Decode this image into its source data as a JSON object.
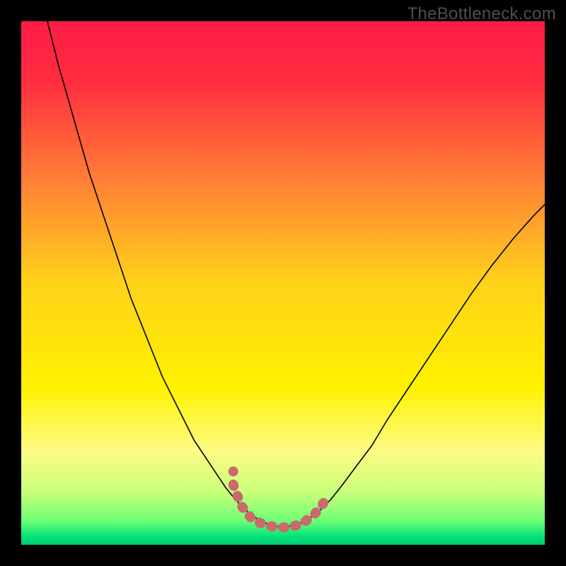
{
  "watermark": "TheBottleneck.com",
  "chart_data": {
    "type": "line",
    "title": "",
    "xlabel": "",
    "ylabel": "",
    "xlim": [
      0,
      100
    ],
    "ylim": [
      0,
      100
    ],
    "background_gradient": {
      "stops": [
        {
          "pos": 0.0,
          "color": "#ff1a47"
        },
        {
          "pos": 0.12,
          "color": "#ff2f3f"
        },
        {
          "pos": 0.3,
          "color": "#ff7e36"
        },
        {
          "pos": 0.5,
          "color": "#ffd21a"
        },
        {
          "pos": 0.7,
          "color": "#fff200"
        },
        {
          "pos": 0.82,
          "color": "#fffb85"
        },
        {
          "pos": 0.9,
          "color": "#c9ff7a"
        },
        {
          "pos": 0.955,
          "color": "#6bff74"
        },
        {
          "pos": 0.985,
          "color": "#00e27a"
        },
        {
          "pos": 1.0,
          "color": "#00c86f"
        }
      ]
    },
    "series": [
      {
        "name": "bottleneck-curve",
        "color": "#000000",
        "width": 1.6,
        "points": [
          [
            5,
            100
          ],
          [
            7,
            92
          ],
          [
            9,
            85
          ],
          [
            11,
            78
          ],
          [
            13,
            71
          ],
          [
            15,
            65
          ],
          [
            17,
            59
          ],
          [
            19,
            53
          ],
          [
            21,
            47
          ],
          [
            23,
            42
          ],
          [
            25,
            37
          ],
          [
            27,
            32
          ],
          [
            29,
            28
          ],
          [
            31,
            24
          ],
          [
            33,
            20
          ],
          [
            35,
            17
          ],
          [
            37,
            14
          ],
          [
            39,
            11
          ],
          [
            41,
            8.5
          ],
          [
            43,
            6.5
          ],
          [
            45,
            5
          ],
          [
            47,
            4
          ],
          [
            49,
            3.5
          ],
          [
            50,
            3.3
          ],
          [
            51,
            3.5
          ],
          [
            53,
            4
          ],
          [
            55,
            5
          ],
          [
            57,
            6.5
          ],
          [
            59,
            8.5
          ],
          [
            61,
            11
          ],
          [
            64,
            15
          ],
          [
            67,
            19
          ],
          [
            70,
            24
          ],
          [
            74,
            30
          ],
          [
            78,
            36
          ],
          [
            82,
            42
          ],
          [
            86,
            48
          ],
          [
            90,
            53.5
          ],
          [
            94,
            58.5
          ],
          [
            98,
            63
          ],
          [
            100,
            65
          ]
        ]
      },
      {
        "name": "marker-band",
        "color": "#cb6a6a",
        "width": 14,
        "dash": [
          2,
          15
        ],
        "points": [
          [
            40.5,
            11.5
          ],
          [
            42,
            7.5
          ],
          [
            44,
            5
          ],
          [
            46,
            4
          ],
          [
            48,
            3.5
          ],
          [
            50,
            3.3
          ],
          [
            52,
            3.5
          ],
          [
            54,
            4.3
          ],
          [
            56,
            5.8
          ],
          [
            58,
            8.3
          ]
        ]
      },
      {
        "name": "marker-dot",
        "color": "#cb6a6a",
        "type_hint": "dot",
        "radius": 7,
        "points": [
          [
            40.5,
            14
          ]
        ]
      }
    ]
  }
}
